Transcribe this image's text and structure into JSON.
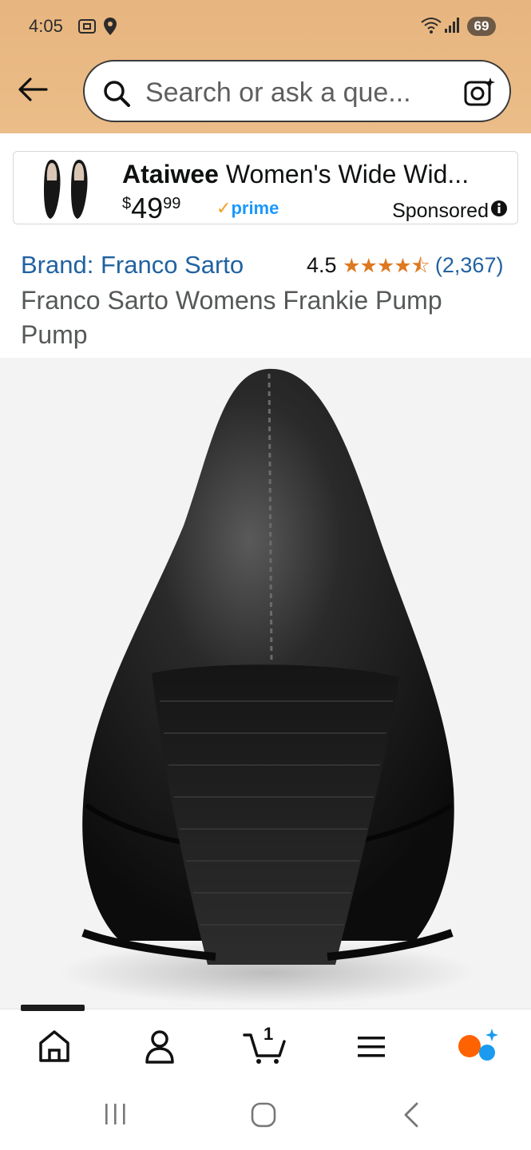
{
  "status_bar": {
    "time": "4:05",
    "battery": "69",
    "icons": [
      "screenshot-icon",
      "location-icon",
      "wifi-icon",
      "signal-icon",
      "battery-icon"
    ]
  },
  "header": {
    "back_icon": "back-arrow-icon",
    "search_placeholder": "Search or ask a que...",
    "camera_icon": "camera-search-icon"
  },
  "sponsored_ad": {
    "brand": "Ataiwee",
    "title_rest": " Women's Wide Wid...",
    "price_symbol": "$",
    "price_whole": "49",
    "price_fraction": "99",
    "prime_label": "prime",
    "sponsored_label": "Sponsored"
  },
  "product": {
    "brand_link": "Brand: Franco Sarto",
    "rating_value": "4.5",
    "stars_text": "★★★★⯪",
    "rating_count": "(2,367)",
    "title": "Franco Sarto Womens Frankie Pump Pump"
  },
  "bottom_nav": {
    "items": [
      "home-icon",
      "account-icon",
      "cart-icon",
      "menu-icon",
      "rufus-ai-icon"
    ],
    "cart_count": "1"
  },
  "colors": {
    "header_bg": "#e9b883",
    "link": "#2162a1",
    "star": "#de7921",
    "prime": "#1a98ff"
  }
}
